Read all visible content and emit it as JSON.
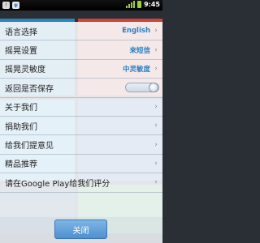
{
  "status_bar": {
    "time": "9:45",
    "left_icons": [
      "warning-icon",
      "usb-icon"
    ],
    "right_icons": [
      "signal-icon",
      "battery-icon"
    ]
  },
  "settings": {
    "language": {
      "label": "语言选择",
      "value": "English"
    },
    "shake": {
      "label": "摇晃设置",
      "value": "来短信"
    },
    "sensitivity": {
      "label": "摇晃灵敏度",
      "value": "中灵敏度"
    },
    "back_save": {
      "label": "返回是否保存",
      "toggle_on": true
    },
    "about": {
      "label": "关于我们"
    },
    "donate": {
      "label": "捐助我们"
    },
    "feedback": {
      "label": "给我们提意见"
    },
    "recommend": {
      "label": "精品推荐"
    },
    "rate": {
      "label": "请在Google Play给我们评分"
    }
  },
  "close_button": {
    "label": "关闭"
  },
  "colors": {
    "accent": "#2a7fc2",
    "tile_blue": "#2f83b9",
    "tile_red": "#d0453a",
    "tile_cyan": "#3aa7d6",
    "tile_green": "#2e9f4a"
  }
}
